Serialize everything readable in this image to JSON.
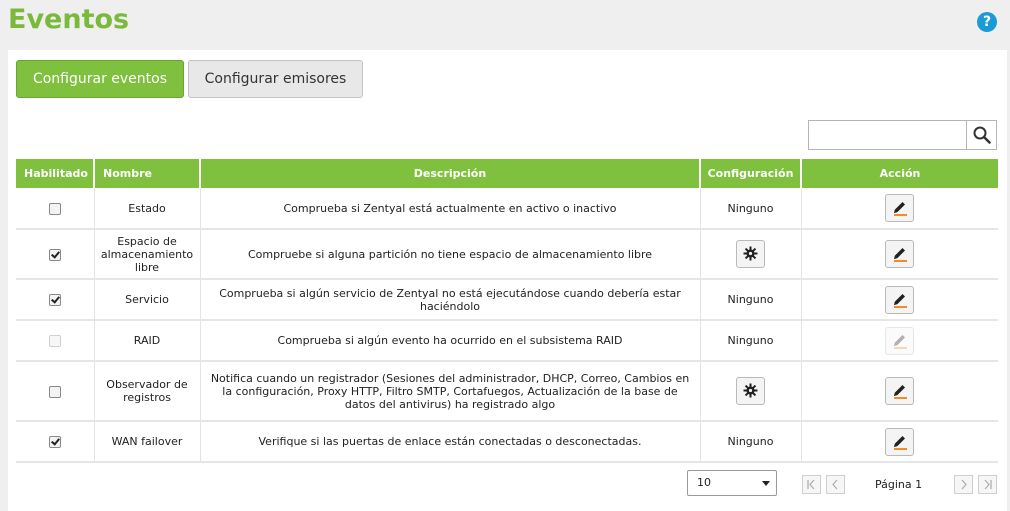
{
  "page": {
    "title": "Eventos",
    "help_icon": "help-icon",
    "help_glyph": "?"
  },
  "tabs": [
    {
      "label": "Configurar eventos",
      "active": true
    },
    {
      "label": "Configurar emisores",
      "active": false
    }
  ],
  "search": {
    "placeholder": "",
    "icon": "search-icon"
  },
  "table": {
    "headers": {
      "enabled": "Habilitado",
      "name": "Nombre",
      "description": "Descripción",
      "configuration": "Configuración",
      "action": "Acción"
    },
    "rows": [
      {
        "enabled": false,
        "enabled_disabled": false,
        "name": "Estado",
        "description": "Comprueba si Zentyal está actualmente en activo o inactivo",
        "configuration": "Ninguno",
        "config_button": false,
        "edit_disabled": false
      },
      {
        "enabled": true,
        "enabled_disabled": false,
        "name": "Espacio de almacenamiento libre",
        "description": "Compruebe si alguna partición no tiene espacio de almacenamiento libre",
        "configuration": "",
        "config_button": true,
        "edit_disabled": false
      },
      {
        "enabled": true,
        "enabled_disabled": false,
        "name": "Servicio",
        "description": "Comprueba si algún servicio de Zentyal no está ejecutándose cuando debería estar haciéndolo",
        "configuration": "Ninguno",
        "config_button": false,
        "edit_disabled": false
      },
      {
        "enabled": false,
        "enabled_disabled": true,
        "name": "RAID",
        "description": "Comprueba si algún evento ha ocurrido en el subsistema RAID",
        "configuration": "Ninguno",
        "config_button": false,
        "edit_disabled": true
      },
      {
        "enabled": false,
        "enabled_disabled": false,
        "name": "Observador de registros",
        "description": "Notifica cuando un registrador (Sesiones del administrador, DHCP, Correo, Cambios en la configuración, Proxy HTTP, Filtro SMTP, Cortafuegos, Actualización de la base de datos del antivirus) ha registrado algo",
        "configuration": "",
        "config_button": true,
        "edit_disabled": false
      },
      {
        "enabled": true,
        "enabled_disabled": false,
        "name": "WAN failover",
        "description": "Verifique si las puertas de enlace están conectadas o desconectadas.",
        "configuration": "Ninguno",
        "config_button": false,
        "edit_disabled": false
      }
    ]
  },
  "pager": {
    "page_size": "10",
    "page_label": "Página 1",
    "first_icon": "first-page-icon",
    "prev_icon": "prev-page-icon",
    "next_icon": "next-page-icon",
    "last_icon": "last-page-icon"
  },
  "colors": {
    "accent": "#7fc03f",
    "title": "#7ab93a",
    "help": "#1a9bd6",
    "edit_underline": "#f28c28"
  }
}
